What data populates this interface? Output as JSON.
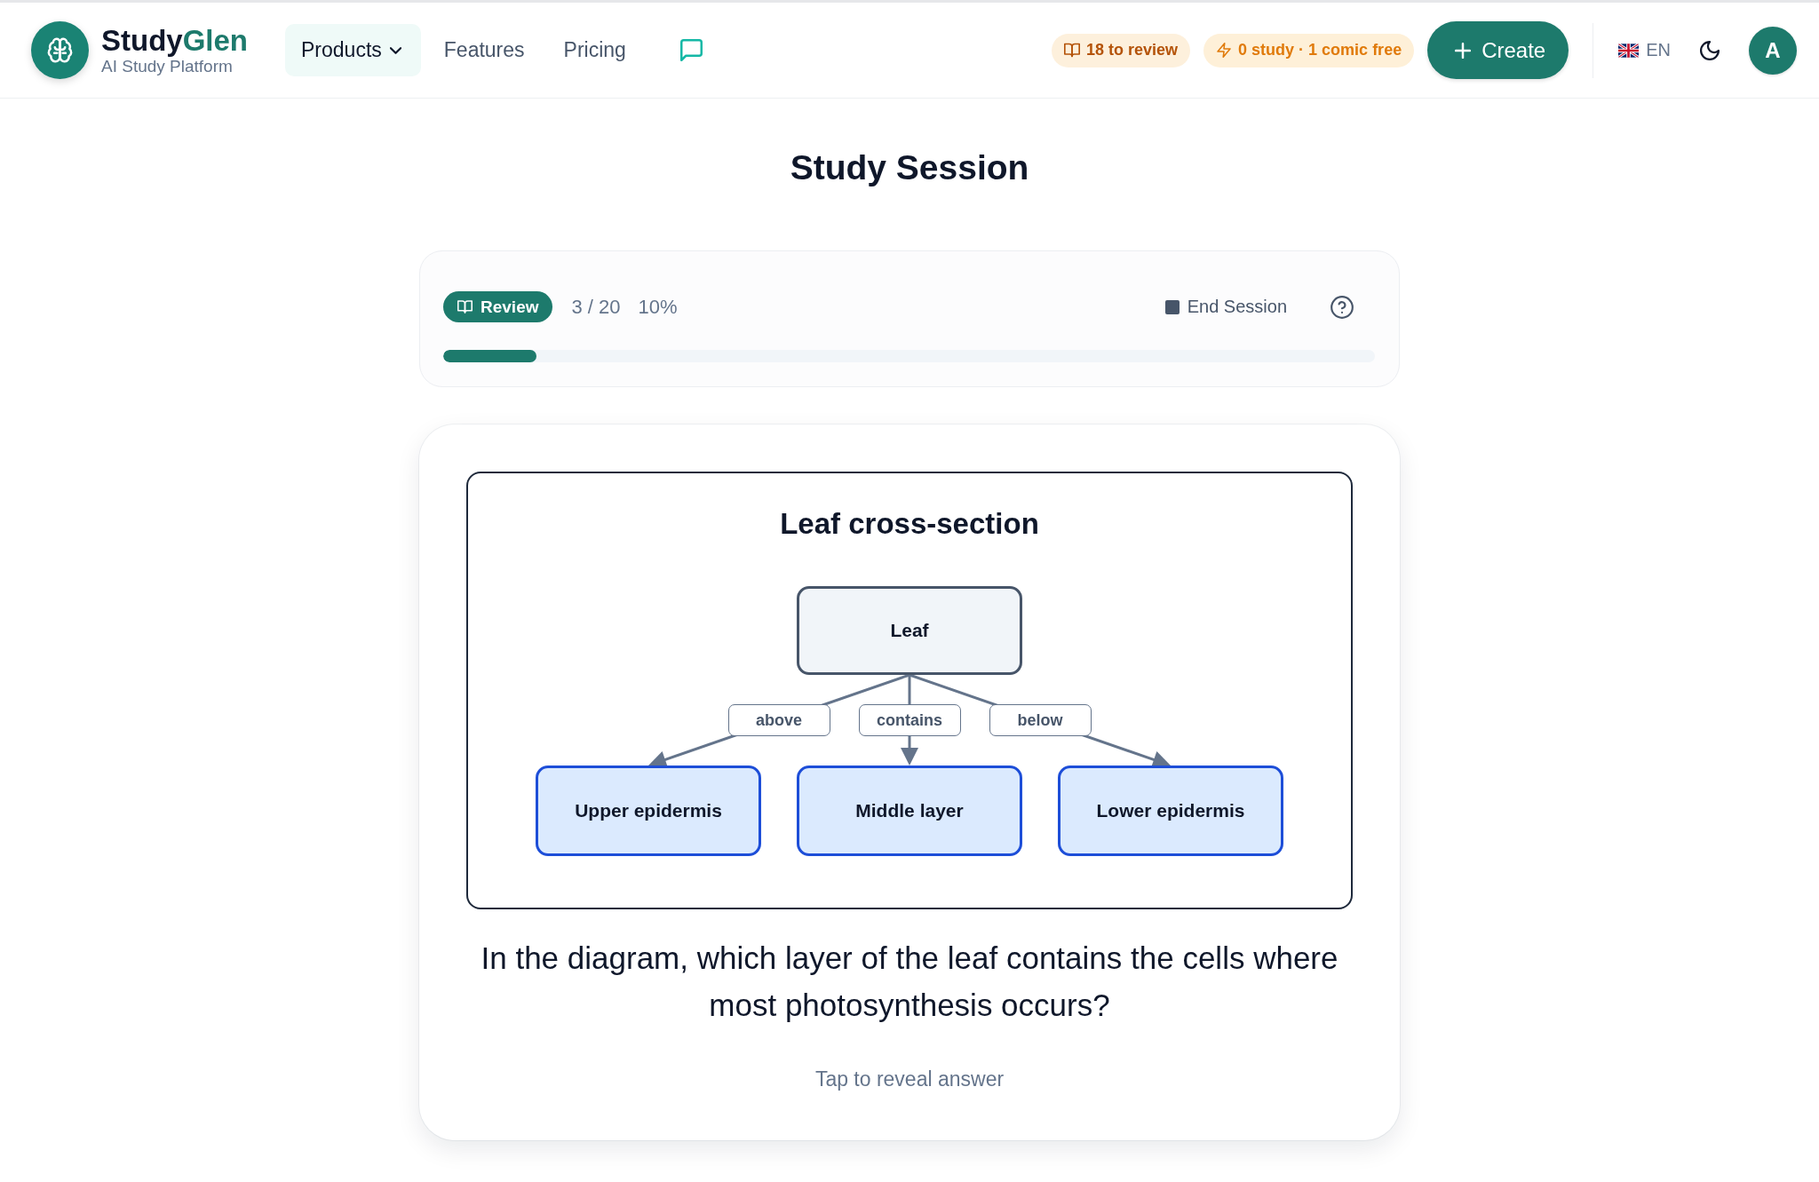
{
  "header": {
    "brand": {
      "primary": "Study",
      "accent": "Glen"
    },
    "tagline": "AI Study Platform",
    "nav": [
      {
        "label": "Products",
        "kind": "dropdown",
        "selected": true
      },
      {
        "label": "Features",
        "kind": "link",
        "selected": false
      },
      {
        "label": "Pricing",
        "kind": "link",
        "selected": false
      }
    ],
    "badges": [
      {
        "kind": "review",
        "label": "18 to review"
      },
      {
        "kind": "credits",
        "label": "0 study · 1 comic free"
      }
    ],
    "create_button": "Create",
    "language": "EN",
    "avatar": "A"
  },
  "page_title": "Study Session",
  "session": {
    "mode": "Review",
    "count": "3 / 20",
    "percent": "10%",
    "end_button": "End Session",
    "progress": {
      "level": 0.1
    }
  },
  "card": {
    "diagram": {
      "title": "Leaf cross-section",
      "root": {
        "label": "Leaf",
        "children": [
          {
            "label": "Upper epidermis",
            "edge_label": "above"
          },
          {
            "label": "Middle layer",
            "edge_label": "contains"
          },
          {
            "label": "Lower epidermis",
            "edge_label": "below"
          }
        ]
      }
    },
    "question": "In the diagram, which layer of the leaf contains the cells where most photosynthesis occurs?",
    "hint": "Tap to reveal answer"
  }
}
